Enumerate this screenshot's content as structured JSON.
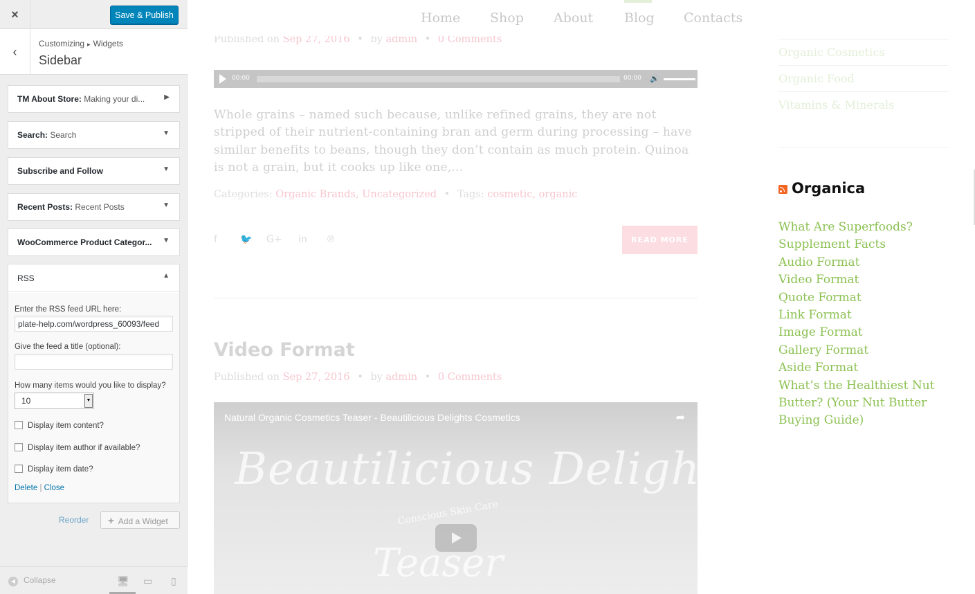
{
  "customizer": {
    "close_icon": "×",
    "save_label": "Save & Publish",
    "back_icon": "‹",
    "breadcrumb": [
      "Customizing",
      "Widgets"
    ],
    "breadcrumb_sep": "▸",
    "section_title": "Sidebar",
    "widgets": [
      {
        "title": "TM About Store:",
        "subtitle": " Making your di...",
        "arrow": "▶"
      },
      {
        "title": "Search:",
        "subtitle": " Search",
        "arrow": "▼"
      },
      {
        "title": "Subscribe and Follow",
        "subtitle": "",
        "arrow": "▼"
      },
      {
        "title": "Recent Posts:",
        "subtitle": " Recent Posts",
        "arrow": "▼"
      },
      {
        "title": "WooCommerce Product Categor...",
        "subtitle": "",
        "arrow": "▼"
      }
    ],
    "rss_widget": {
      "title": "RSS",
      "arrow": "▲",
      "url_label": "Enter the RSS feed URL here:",
      "url_value": "plate-help.com/wordpress_60093/feed",
      "title_label": "Give the feed a title (optional):",
      "title_value": "",
      "items_label": "How many items would you like to display?",
      "items_value": "10",
      "options": [
        "Display item content?",
        "Display item author if available?",
        "Display item date?"
      ],
      "delete_label": "Delete",
      "separator": "|",
      "close_label": "Close"
    },
    "reorder_label": "Reorder",
    "add_widget_label": "Add a Widget",
    "collapse_label": "Collapse"
  },
  "preview": {
    "nav": [
      "Home",
      "Shop",
      "About",
      "Blog",
      "Contacts"
    ],
    "post1": {
      "meta_published": "Published on",
      "meta_date": "Sep 27, 2016",
      "meta_by": "by",
      "meta_author": "admin",
      "meta_comments": "0 Comments",
      "audio_time_start": "00:00",
      "audio_time_end": "00:00",
      "excerpt": "Whole grains – named such because, unlike refined grains, they are not stripped of their nutrient-containing bran and germ during processing – have similar benefits to beans, though they don’t contain as much protein. Quinoa is not a grain, but it cooks up like one,...",
      "categories_label": "Categories:",
      "categories": "Organic Brands, Uncategorized",
      "tags_label": "Tags:",
      "tags": "cosmetic, organic",
      "read_more": "READ MORE"
    },
    "post2": {
      "title": "Video Format",
      "meta_published": "Published on",
      "meta_date": "Sep 27, 2016",
      "meta_by": "by",
      "meta_author": "admin",
      "meta_comments": "0 Comments",
      "video_caption": "Natural Organic Cosmetics Teaser - Beautilicious Delights Cosmetics",
      "video_brand": "Beautilicious Delights",
      "video_tagline": "Conscious Skin Care",
      "video_teaser": "Teaser"
    },
    "categories_list": [
      "Organic Cosmetics",
      "Organic Food",
      "Vitamins & Minerals"
    ],
    "rss_heading": "Organica",
    "rss_items": [
      "What Are Superfoods?",
      "Supplement Facts",
      "Audio Format",
      "Video Format",
      "Quote Format",
      "Link Format",
      "Image Format",
      "Gallery Format",
      "Aside Format",
      "What’s the Healthiest Nut Butter? (Your Nut Butter Buying Guide)"
    ]
  }
}
